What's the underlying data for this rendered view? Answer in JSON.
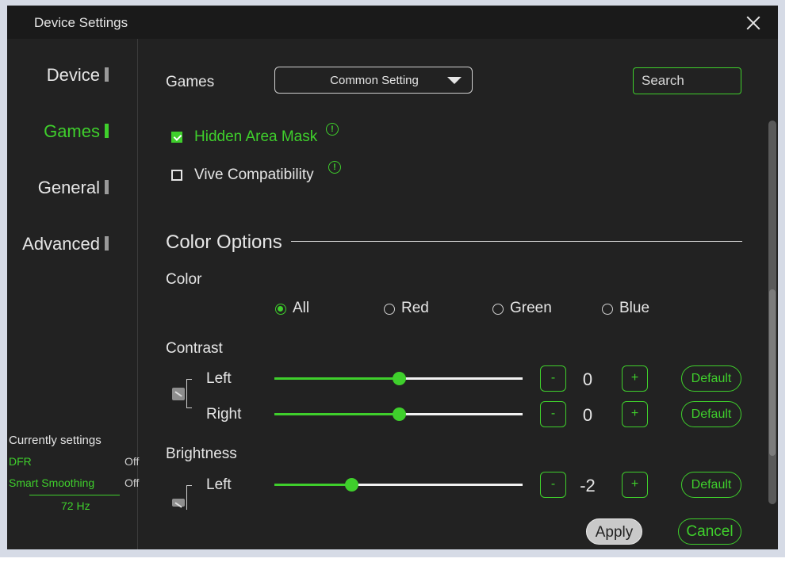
{
  "window": {
    "title": "Device Settings"
  },
  "sidebar": {
    "items": [
      {
        "label": "Device",
        "active": false
      },
      {
        "label": "Games",
        "active": true
      },
      {
        "label": "General",
        "active": false
      },
      {
        "label": "Advanced",
        "active": false
      }
    ],
    "current": {
      "title": "Currently settings",
      "dfr_label": "DFR",
      "dfr_value": "Off",
      "smoothing_label": "Smart Smoothing",
      "smoothing_value": "Off",
      "refresh": "72 Hz"
    }
  },
  "games": {
    "label": "Games",
    "dropdown_value": "Common Setting",
    "search_placeholder": "Search",
    "hidden_area_mask": {
      "label": "Hidden Area Mask",
      "checked": true
    },
    "vive_compat": {
      "label": "Vive Compatibility",
      "checked": false
    }
  },
  "color_options": {
    "title": "Color Options",
    "color_label": "Color",
    "radios": [
      {
        "label": "All",
        "selected": true
      },
      {
        "label": "Red",
        "selected": false
      },
      {
        "label": "Green",
        "selected": false
      },
      {
        "label": "Blue",
        "selected": false
      }
    ],
    "contrast": {
      "label": "Contrast",
      "left": {
        "label": "Left",
        "value": "0",
        "slider": 0.5
      },
      "right": {
        "label": "Right",
        "value": "0",
        "slider": 0.5
      }
    },
    "brightness": {
      "label": "Brightness",
      "left": {
        "label": "Left",
        "value": "-2",
        "slider": 0.31
      }
    },
    "minus": "-",
    "plus": "+",
    "default_label": "Default"
  },
  "footer": {
    "apply": "Apply",
    "cancel": "Cancel"
  },
  "colors": {
    "accent": "#3fcf2c",
    "background": "#222222"
  }
}
